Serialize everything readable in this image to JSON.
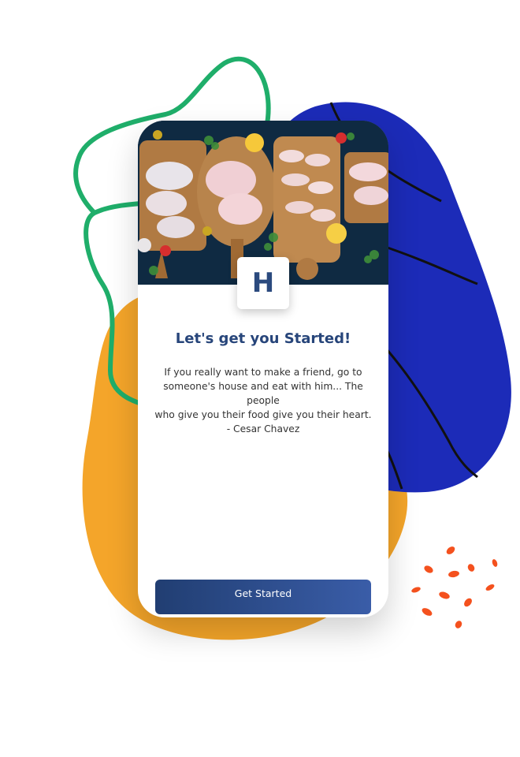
{
  "onboarding": {
    "logo_letter": "H",
    "title": "Let's get you Started!",
    "quote_lines": [
      "If you really want to make a friend, go to",
      "someone's house and eat with him... The people",
      "who give you their food give you their heart.",
      "- Cesar Chavez"
    ],
    "cta_label": "Get Started"
  },
  "colors": {
    "brand_blue": "#27457a",
    "blob_blue": "#1c2bb8",
    "blob_orange": "#f4a52a",
    "outline_green": "#1fae6a",
    "confetti_red": "#f4511e"
  },
  "hero_image": {
    "icon": "raw-chicken-on-cutting-boards-image"
  }
}
